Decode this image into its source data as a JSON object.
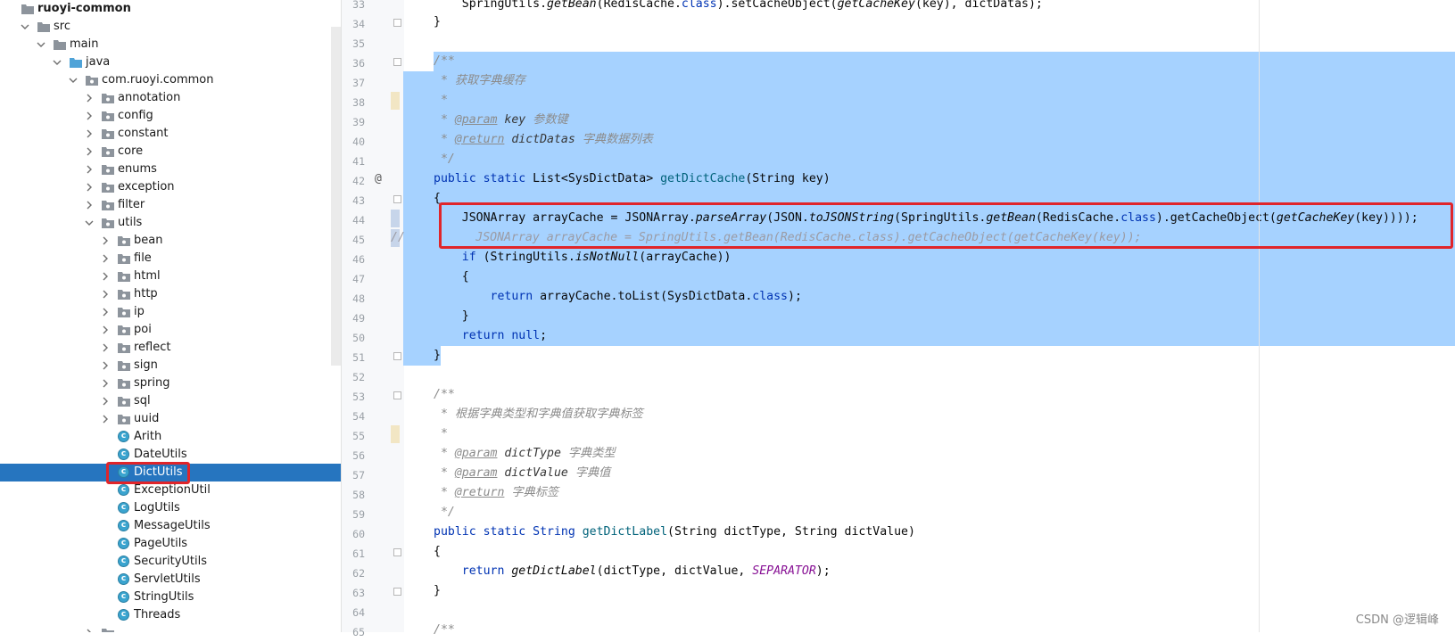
{
  "project_tree": {
    "root": "ruoyi-common",
    "src": "src",
    "main": "main",
    "java": "java",
    "package": "com.ruoyi.common",
    "subpackages": [
      "annotation",
      "config",
      "constant",
      "core",
      "enums",
      "exception",
      "filter"
    ],
    "utils": "utils",
    "utils_packages": [
      "bean",
      "file",
      "html",
      "http",
      "ip",
      "poi",
      "reflect",
      "sign",
      "spring",
      "sql",
      "uuid"
    ],
    "utils_classes": [
      "Arith",
      "DateUtils",
      "DictUtils",
      "ExceptionUtil",
      "LogUtils",
      "MessageUtils",
      "PageUtils",
      "SecurityUtils",
      "ServletUtils",
      "StringUtils",
      "Threads"
    ],
    "selected": "DictUtils",
    "class_icon_letter": "c"
  },
  "editor": {
    "line_numbers": [
      "33",
      "34",
      "35",
      "36",
      "37",
      "38",
      "39",
      "40",
      "41",
      "42",
      "43",
      "44",
      "45",
      "46",
      "47",
      "48",
      "49",
      "50",
      "51",
      "52",
      "53",
      "54",
      "55",
      "56",
      "57",
      "58",
      "59",
      "60",
      "61",
      "62",
      "63",
      "64",
      "65"
    ],
    "override_marker": "@",
    "comment_prefix": "//",
    "lines": {
      "l33": {
        "a": "SpringUtils.",
        "b": "getBean",
        "c": "(RedisCache.",
        "d": "class",
        "e": ").setCacheObject(",
        "f": "getCacheKey",
        "g": "(key), dictDatas);"
      },
      "l34": "}",
      "l36": "/**",
      "l37": " * 获取字典缓存",
      "l38": " *",
      "l39": {
        "star": " * ",
        "tag": "@param",
        "name": " key ",
        "desc": "参数键"
      },
      "l40": {
        "star": " * ",
        "tag": "@return",
        "name": " dictDatas ",
        "desc": "字典数据列表"
      },
      "l41": " */",
      "l42": {
        "kw": "public static ",
        "type": "List<SysDictData> ",
        "fn": "getDictCache",
        "rest": "(String key)"
      },
      "l43": "{",
      "l44": {
        "a": "JSONArray arrayCache = JSONArray.",
        "b": "parseArray",
        "c": "(JSON.",
        "d": "toJSONString",
        "e": "(SpringUtils.",
        "f": "getBean",
        "g": "(RedisCache.",
        "h": "class",
        "i": ").getCacheObject(",
        "j": "getCacheKey",
        "k": "(key))));"
      },
      "l45": "  JSONArray arrayCache = SpringUtils.getBean(RedisCache.class).getCacheObject(getCacheKey(key));",
      "l46": {
        "kw": "if ",
        "a": "(StringUtils.",
        "b": "isNotNull",
        "c": "(arrayCache))"
      },
      "l47": "{",
      "l48": {
        "kw": "return ",
        "a": "arrayCache.toList(SysDictData.",
        "b": "class",
        "c": ");"
      },
      "l49": "}",
      "l50": {
        "kw": "return ",
        "b": "null",
        ";": ";"
      },
      "l51": "}",
      "l53": "/**",
      "l54": " * 根据字典类型和字典值获取字典标签",
      "l55": " *",
      "l56": {
        "star": " * ",
        "tag": "@param",
        "name": " dictType ",
        "desc": "字典类型"
      },
      "l57": {
        "star": " * ",
        "tag": "@param",
        "name": " dictValue ",
        "desc": "字典值"
      },
      "l58": {
        "star": " * ",
        "tag": "@return",
        "name": " ",
        "desc": "字典标签"
      },
      "l59": " */",
      "l60": {
        "kw": "public static ",
        "type": "String ",
        "fn": "getDictLabel",
        "rest": "(String dictType, String dictValue)"
      },
      "l61": "{",
      "l62": {
        "kw": "return ",
        "fn": "getDictLabel",
        "a": "(dictType, dictValue, ",
        "cst": "SEPARATOR",
        "b": ");"
      },
      "l63": "}",
      "l65": "/**"
    }
  },
  "watermark": "CSDN @逻辑峰",
  "colors": {
    "selection": "#a6d2ff",
    "tree_selected": "#2675bf",
    "highlight_box": "#e0252a"
  }
}
